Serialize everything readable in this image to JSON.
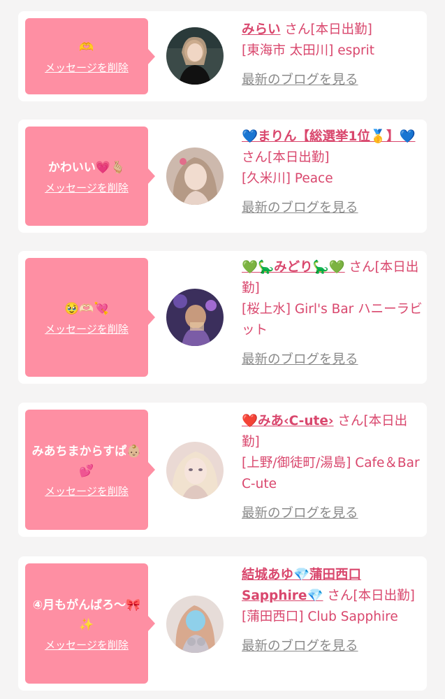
{
  "labels": {
    "delete": "メッセージを削除",
    "blog": "最新のブログを見る"
  },
  "cards": [
    {
      "message": "🫶",
      "name": "みらい",
      "suffix": "さん[本日出勤]",
      "shop": "[東海市 太田川] esprit",
      "avatar_icon": "avatar-photo-icon"
    },
    {
      "message": "かわいい💗🫰🏼",
      "name": "💙まりん【総選挙1位🥇】💙",
      "suffix": "さん[本日出勤]",
      "shop": "[久米川] Peace",
      "avatar_icon": "avatar-photo-icon"
    },
    {
      "message": "🥹🫶🏻💘",
      "name": "💚🦕みどり🦕💚",
      "suffix": "さん[本日出勤]",
      "shop": "[桜上水] Girl's Bar ハニーラビット",
      "avatar_icon": "avatar-photo-icon"
    },
    {
      "message": "みあちまからすぱ👶🏼💕",
      "name": "❤️みあ‹C-ute›",
      "suffix": "さん[本日出勤]",
      "shop": "[上野/御徒町/湯島] Cafe＆Bar C-ute",
      "avatar_icon": "avatar-photo-icon"
    },
    {
      "message": "④月もがんばろ〜🎀✨",
      "name": "結城あゆ💎蒲田西口Sapphire💎",
      "suffix": "さん[本日出勤]",
      "shop": "[蒲田西口] Club Sapphire",
      "avatar_icon": "avatar-photo-icon"
    }
  ]
}
